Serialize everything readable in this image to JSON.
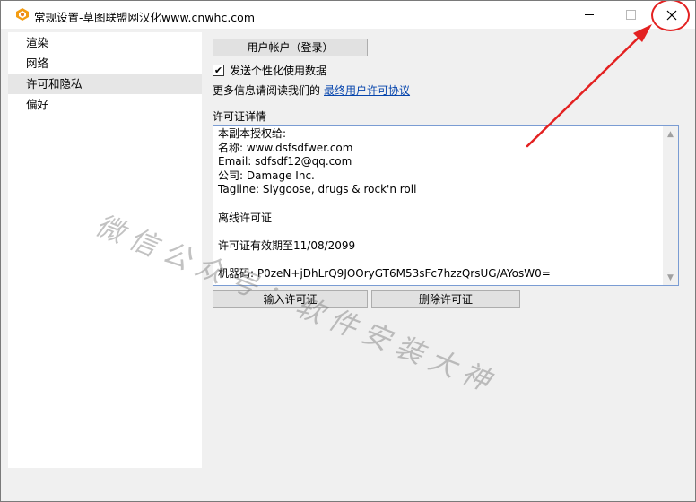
{
  "window": {
    "title": "常规设置-草图联盟网汉化www.cnwhc.com"
  },
  "sidebar": {
    "items": [
      {
        "label": "渲染"
      },
      {
        "label": "网络"
      },
      {
        "label": "许可和隐私"
      },
      {
        "label": "偏好"
      }
    ]
  },
  "content": {
    "user_account_button": "用户帐户（登录）",
    "send_data_label": "发送个性化使用数据",
    "send_data_checked": true,
    "more_info_text": "更多信息请阅读我们的",
    "eula_link": "最终用户许可协议",
    "license_details_label": "许可证详情",
    "license_lines": [
      "本副本授权给:",
      "名称: www.dsfsdfwer.com",
      "Email: sdfsdf12@qq.com",
      "公司: Damage Inc.",
      "Tagline: Slygoose, drugs & rock'n roll",
      "",
      "离线许可证",
      "",
      "许可证有效期至11/08/2099",
      "",
      "机器码: P0zeN+jDhLrQ9JOOryGT6M53sFc7hzzQrsUG/AYosW0="
    ],
    "import_license_button": "输入许可证",
    "remove_license_button": "删除许可证"
  },
  "watermark": "微信公众号：软件安装大神",
  "colors": {
    "annotation_red": "#e32121",
    "link": "#0645ad",
    "selected_bg": "#e6e6e6"
  }
}
